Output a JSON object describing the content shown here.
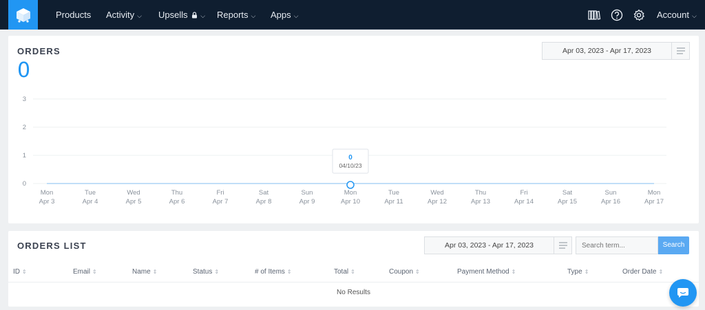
{
  "nav": {
    "items": [
      {
        "label": "Products",
        "caret": false,
        "lock": false
      },
      {
        "label": "Activity",
        "caret": true,
        "lock": false
      },
      {
        "label": "Upsells",
        "caret": true,
        "lock": true
      },
      {
        "label": "Reports",
        "caret": true,
        "lock": false
      },
      {
        "label": "Apps",
        "caret": true,
        "lock": false
      }
    ],
    "account_label": "Account",
    "right_icons": [
      "library-icon",
      "help-icon",
      "settings-icon"
    ]
  },
  "orders": {
    "title": "ORDERS",
    "count": "0",
    "date_range": "Apr 03, 2023  -  Apr 17, 2023"
  },
  "chart_data": {
    "type": "line",
    "y_ticks": [
      "0",
      "1",
      "2",
      "3"
    ],
    "ylim": [
      0,
      3
    ],
    "grid": true,
    "x": [
      {
        "day": "Mon",
        "date": "Apr 3"
      },
      {
        "day": "Tue",
        "date": "Apr 4"
      },
      {
        "day": "Wed",
        "date": "Apr 5"
      },
      {
        "day": "Thu",
        "date": "Apr 6"
      },
      {
        "day": "Fri",
        "date": "Apr 7"
      },
      {
        "day": "Sat",
        "date": "Apr 8"
      },
      {
        "day": "Sun",
        "date": "Apr 9"
      },
      {
        "day": "Mon",
        "date": "Apr 10"
      },
      {
        "day": "Tue",
        "date": "Apr 11"
      },
      {
        "day": "Wed",
        "date": "Apr 12"
      },
      {
        "day": "Thu",
        "date": "Apr 13"
      },
      {
        "day": "Fri",
        "date": "Apr 14"
      },
      {
        "day": "Sat",
        "date": "Apr 15"
      },
      {
        "day": "Sun",
        "date": "Apr 16"
      },
      {
        "day": "Mon",
        "date": "Apr 17"
      }
    ],
    "values": [
      0,
      0,
      0,
      0,
      0,
      0,
      0,
      0,
      0,
      0,
      0,
      0,
      0,
      0,
      0
    ],
    "highlight_index": 7,
    "tooltip": {
      "value": "0",
      "date": "04/10/23"
    },
    "colors": {
      "line": "#2196f3",
      "grid": "#eef0f2",
      "tick": "#8a929c"
    }
  },
  "orders_list": {
    "title": "ORDERS LIST",
    "date_range": "Apr 03, 2023  -  Apr 17, 2023",
    "search_placeholder": "Search term...",
    "search_button": "Search",
    "columns": [
      "ID",
      "Email",
      "Name",
      "Status",
      "# of Items",
      "Total",
      "Coupon",
      "Payment Method",
      "Type",
      "Order Date"
    ],
    "empty_text": "No Results"
  },
  "colors": {
    "brand": "#2196f3",
    "nav_bg": "#0f1e30"
  }
}
